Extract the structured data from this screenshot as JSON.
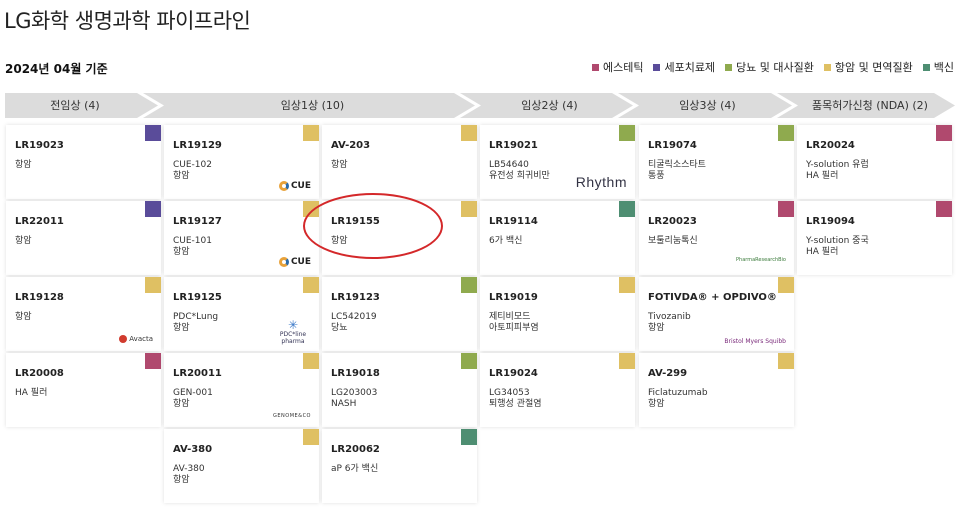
{
  "page": {
    "title": "LG화학 생명과학 파이프라인",
    "date": "2024년 04월 기준"
  },
  "legend": [
    {
      "label": "에스테틱",
      "color": "#b0496e"
    },
    {
      "label": "세포치료제",
      "color": "#5a4c9a"
    },
    {
      "label": "당뇨 및 대사질환",
      "color": "#8faa4e"
    },
    {
      "label": "항암 및 면역질환",
      "color": "#dfc063"
    },
    {
      "label": "백신",
      "color": "#4e8e72"
    }
  ],
  "phases": [
    {
      "label": "전임상 (4)"
    },
    {
      "label": "임상1상 (10)"
    },
    {
      "label": "임상2상 (4)"
    },
    {
      "label": "임상3상 (4)"
    },
    {
      "label": "품목허가신청 (NDA) (2)"
    }
  ],
  "cards": [
    {
      "code": "LR19023",
      "desc": "항암",
      "color": "#5a4c9a",
      "logo": ""
    },
    {
      "code": "LR22011",
      "desc": "항암",
      "color": "#5a4c9a",
      "logo": ""
    },
    {
      "code": "LR19128",
      "desc": "항암",
      "color": "#dfc063",
      "logo": "Avacta"
    },
    {
      "code": "LR20008",
      "desc": "HA 필러",
      "color": "#b0496e",
      "logo": ""
    },
    {
      "code": "LR19129",
      "desc": "CUE-102\n항암",
      "color": "#dfc063",
      "logo": "CUE"
    },
    {
      "code": "LR19127",
      "desc": "CUE-101\n항암",
      "color": "#dfc063",
      "logo": "CUE"
    },
    {
      "code": "LR19125",
      "desc": "PDC*Lung\n항암",
      "color": "#dfc063",
      "logo": "PDC*line pharma"
    },
    {
      "code": "LR20011",
      "desc": "GEN-001\n항암",
      "color": "#dfc063",
      "logo": "GENOME&CO"
    },
    {
      "code": "AV-380",
      "desc": "AV-380\n항암",
      "color": "#dfc063",
      "logo": ""
    },
    {
      "code": "AV-203",
      "desc": "항암",
      "color": "#dfc063",
      "logo": ""
    },
    {
      "code": "LR19155",
      "desc": "항암",
      "color": "#dfc063",
      "logo": ""
    },
    {
      "code": "LR19123",
      "desc": "LC542019\n당뇨",
      "color": "#8faa4e",
      "logo": ""
    },
    {
      "code": "LR19018",
      "desc": "LG203003\nNASH",
      "color": "#8faa4e",
      "logo": ""
    },
    {
      "code": "LR20062",
      "desc": "aP 6가 백신",
      "color": "#4e8e72",
      "logo": ""
    },
    {
      "code": "LR19021",
      "desc": "LB54640\n유전성 희귀비만",
      "color": "#8faa4e",
      "logo": "Rhythm"
    },
    {
      "code": "LR19114",
      "desc": "6가 백신",
      "color": "#4e8e72",
      "logo": ""
    },
    {
      "code": "LR19019",
      "desc": "제티비모드\n아토피피부염",
      "color": "#dfc063",
      "logo": ""
    },
    {
      "code": "LR19024",
      "desc": "LG34053\n퇴행성 관절염",
      "color": "#dfc063",
      "logo": ""
    },
    {
      "code": "LR19074",
      "desc": "티굴릭소스타트\n통풍",
      "color": "#8faa4e",
      "logo": ""
    },
    {
      "code": "LR20023",
      "desc": "보툴리눔톡신",
      "color": "#b0496e",
      "logo": "PharmaResearchBio"
    },
    {
      "code": "FOTIVDA® + OPDIVO®",
      "desc": "Tivozanib\n항암",
      "color": "#dfc063",
      "logo": "Bristol Myers Squibb"
    },
    {
      "code": "AV-299",
      "desc": "Ficlatuzumab\n항암",
      "color": "#dfc063",
      "logo": ""
    },
    {
      "code": "LR20024",
      "desc": "Y-solution 유럽\nHA 필러",
      "color": "#b0496e",
      "logo": ""
    },
    {
      "code": "LR19094",
      "desc": "Y-solution 중국\nHA 필러",
      "color": "#b0496e",
      "logo": ""
    }
  ]
}
